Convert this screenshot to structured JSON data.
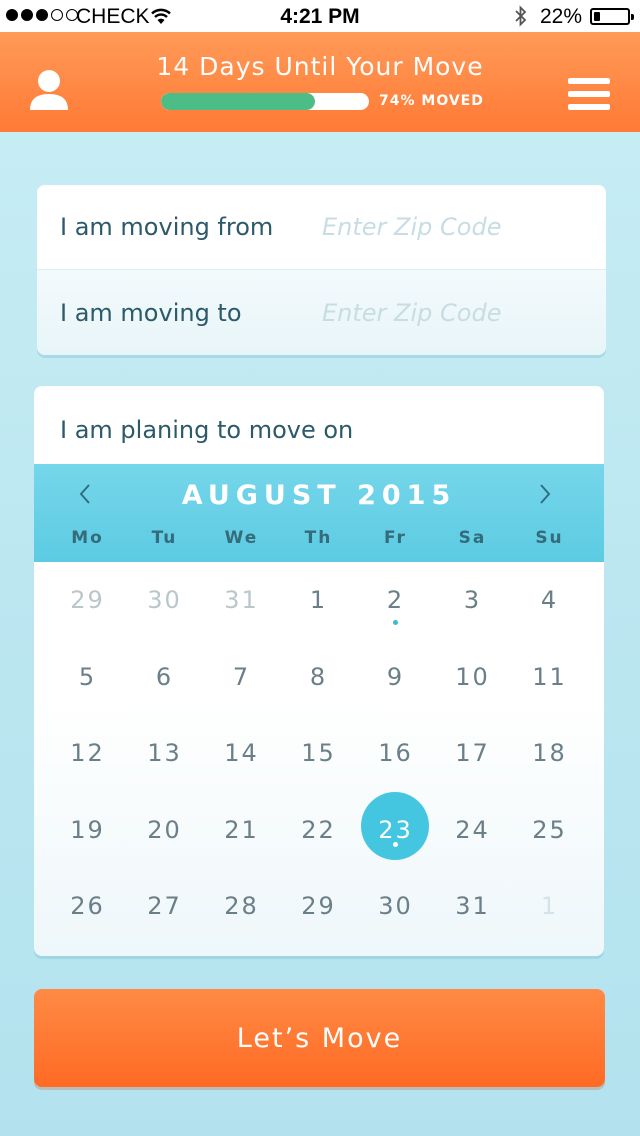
{
  "status_bar": {
    "carrier": "CHECK",
    "time": "4:21 PM",
    "battery": "22%",
    "battery_level": 0.22
  },
  "header": {
    "title": "14 Days Until Your Move",
    "progress_label": "74% MOVED",
    "progress_fraction": 0.74,
    "left_icon": "user-icon",
    "right_icon": "menu-icon"
  },
  "zip": {
    "from_label": "I am moving from",
    "from_placeholder": "Enter Zip Code",
    "from_value": "",
    "to_label": "I am moving to",
    "to_placeholder": "Enter Zip Code",
    "to_value": ""
  },
  "calendar": {
    "question": "I am planing to move on",
    "month": "AUGUST 2015",
    "prev_icon": "chevron-left-icon",
    "next_icon": "chevron-right-icon",
    "weekdays": [
      "Mo",
      "Tu",
      "We",
      "Th",
      "Fr",
      "Sa",
      "Su"
    ],
    "weeks": [
      [
        {
          "d": "29",
          "muted": true
        },
        {
          "d": "30",
          "muted": true
        },
        {
          "d": "31",
          "muted": true
        },
        {
          "d": "1"
        },
        {
          "d": "2",
          "mark": true
        },
        {
          "d": "3"
        },
        {
          "d": "4"
        }
      ],
      [
        {
          "d": "5"
        },
        {
          "d": "6"
        },
        {
          "d": "7"
        },
        {
          "d": "8"
        },
        {
          "d": "9"
        },
        {
          "d": "10"
        },
        {
          "d": "11"
        }
      ],
      [
        {
          "d": "12"
        },
        {
          "d": "13"
        },
        {
          "d": "14"
        },
        {
          "d": "15"
        },
        {
          "d": "16"
        },
        {
          "d": "17"
        },
        {
          "d": "18"
        }
      ],
      [
        {
          "d": "19"
        },
        {
          "d": "20"
        },
        {
          "d": "21"
        },
        {
          "d": "22"
        },
        {
          "d": "23",
          "selected": true,
          "mark": true
        },
        {
          "d": "24"
        },
        {
          "d": "25"
        }
      ],
      [
        {
          "d": "26"
        },
        {
          "d": "27"
        },
        {
          "d": "28"
        },
        {
          "d": "29"
        },
        {
          "d": "30"
        },
        {
          "d": "31"
        },
        {
          "d": "1",
          "next_muted": true
        }
      ]
    ]
  },
  "cta": {
    "label": "Let’s Move"
  },
  "colors": {
    "accent_orange": "#ff7a35",
    "progress_green": "#4cbd87",
    "calendar_blue": "#5ccbe2",
    "selected_blue": "#45c6e0"
  }
}
